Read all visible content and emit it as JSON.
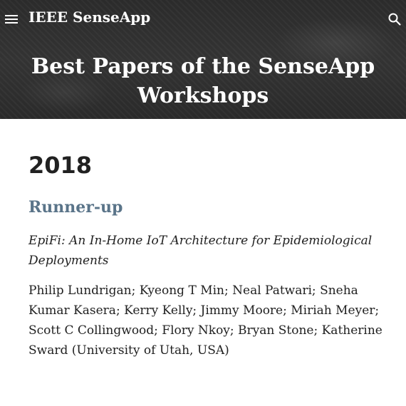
{
  "header": {
    "site_title": "IEEE SenseApp",
    "menu_icon": "hamburger-menu-icon",
    "search_icon": "search-icon"
  },
  "banner": {
    "title": "Best Papers of the SenseApp Workshops"
  },
  "main": {
    "year": "2018",
    "award": "Runner-up",
    "paper_title": "EpiFi: An In-Home IoT Architecture for Epidemiological Deployments",
    "authors": "Philip Lundrigan; Kyeong T Min; Neal Patwari; Sneha Kumar Kasera; Kerry Kelly; Jimmy Moore; Miriah Meyer; Scott C Collingwood; Flory Nkoy; Bryan Stone; Katherine Sward (University of Utah, USA)"
  },
  "colors": {
    "banner_bg": "#2f2f2f",
    "header_text": "#ffffff",
    "award_accent": "#5a7489",
    "body_text": "#212121"
  }
}
